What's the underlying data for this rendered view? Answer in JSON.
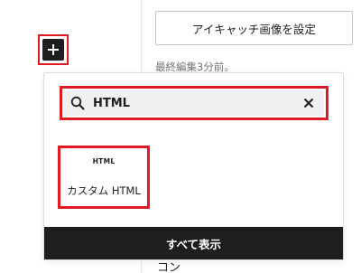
{
  "editor_sidebar": {
    "featured_image_button": "アイキャッチ画像を設定",
    "last_edited": "最終編集3分前。",
    "bottom_peek_text": "コン"
  },
  "inserter": {
    "toggle_icon": "plus-icon",
    "search": {
      "value": "HTML",
      "search_icon": "search-icon",
      "clear_icon": "close-icon"
    },
    "results": [
      {
        "icon_text": "HTML",
        "label": "カスタム HTML"
      }
    ],
    "show_all_label": "すべて表示"
  },
  "colors": {
    "highlight": "#e01a22",
    "dark": "#1e1e1e",
    "search_bg": "#f0f0f0"
  }
}
